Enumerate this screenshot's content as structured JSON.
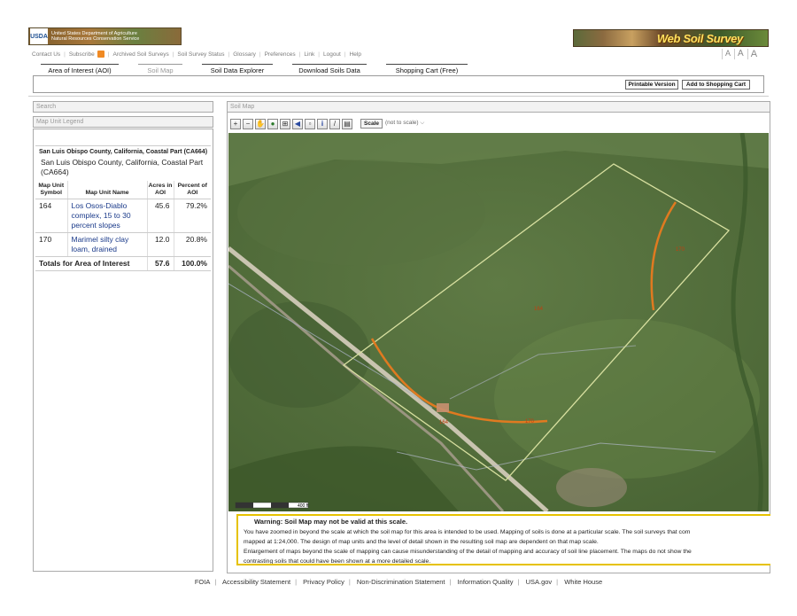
{
  "header": {
    "usda_mark": "USDA",
    "usda_line1": "United States Department of Agriculture",
    "usda_line2": "Natural Resources Conservation Service",
    "app_title": "Web Soil Survey"
  },
  "toplinks": [
    "Contact Us",
    "Subscribe",
    "Archived Soil Surveys",
    "Soil Survey Status",
    "Glossary",
    "Preferences",
    "Link",
    "Logout",
    "Help"
  ],
  "font_sizes": [
    "A",
    "A",
    "A"
  ],
  "tabs": [
    {
      "label": "Area of Interest (AOI)",
      "active": false
    },
    {
      "label": "Soil Map",
      "active": true
    },
    {
      "label": "Soil Data Explorer",
      "active": false
    },
    {
      "label": "Download Soils Data",
      "active": false
    },
    {
      "label": "Shopping Cart (Free)",
      "active": false
    }
  ],
  "actions": {
    "printable": "Printable Version",
    "add_cart": "Add to Shopping Cart"
  },
  "left": {
    "search_label": "Search",
    "legend_label": "Map Unit Legend",
    "area_title": "San Luis Obispo County, California, Coastal Part (CA664)",
    "area_sub": "San Luis Obispo County, California, Coastal Part (CA664)",
    "columns": [
      "Map Unit Symbol",
      "Map Unit Name",
      "Acres in AOI",
      "Percent of AOI"
    ],
    "rows": [
      {
        "symbol": "164",
        "name": "Los Osos-Diablo complex, 15 to 30 percent slopes",
        "acres": "45.6",
        "percent": "79.2%"
      },
      {
        "symbol": "170",
        "name": "Marimel silty clay loam, drained",
        "acres": "12.0",
        "percent": "20.8%"
      }
    ],
    "total": {
      "label": "Totals for Area of Interest",
      "acres": "57.6",
      "percent": "100.0%"
    }
  },
  "map": {
    "panel_label": "Soil Map",
    "scale_label": "Scale",
    "scale_value": "(not to scale)",
    "scalebar_label": "400 ft",
    "unit_labels": [
      "164",
      "170",
      "164",
      "170"
    ],
    "tools": [
      "zoom-in-icon",
      "zoom-out-icon",
      "pan-icon",
      "globe-icon",
      "full-extent-icon",
      "back-icon",
      "forward-icon",
      "info-icon",
      "measure-icon",
      "print-icon"
    ]
  },
  "warning": {
    "title": "Warning: Soil Map may not be valid at this scale.",
    "p1a": "You have zoomed in beyond the scale at which the soil map for this area is intended to be used. Mapping of soils is done at a particular scale. The soil surveys that com",
    "p1b": "mapped at 1:24,000. The design of map units and the level of detail shown in the resulting soil map are dependent on that map scale.",
    "p2a": "Enlargement of maps beyond the scale of mapping can cause misunderstanding of the detail of mapping and accuracy of soil line placement. The maps do not show the",
    "p2b": "contrasting soils that could have been shown at a more detailed scale."
  },
  "footer": [
    "FOIA",
    "Accessibility Statement",
    "Privacy Policy",
    "Non-Discrimination Statement",
    "Information Quality",
    "USA.gov",
    "White House"
  ],
  "colors": {
    "soil_line": "#e07a20",
    "aoi_boundary": "#d8e0a0",
    "warning_border": "#e6c200"
  }
}
